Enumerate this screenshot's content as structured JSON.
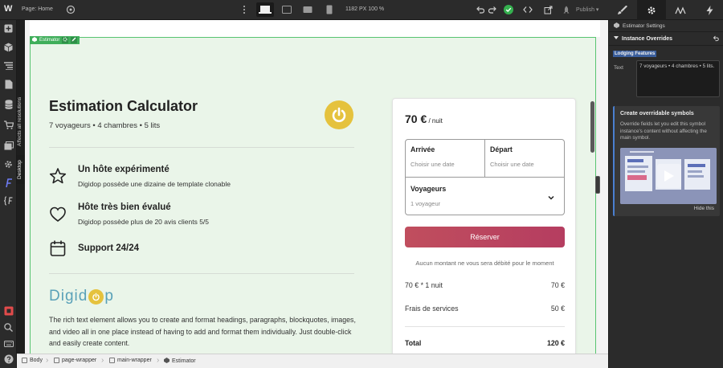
{
  "topbar": {
    "logo": "W",
    "page_label": "Page: Home",
    "dimensions": "1182 PX  100 %",
    "publish_label": "Publish ▾"
  },
  "left_toolbar": {
    "vertical_labels": [
      "Affects all resolutions",
      "Desktop"
    ]
  },
  "canvas": {
    "symbol_tag": "Estimator",
    "calculator": {
      "title": "Estimation Calculator",
      "subtitle": "7 voyageurs • 4 chambres •  5 lits"
    },
    "features": [
      {
        "title": "Un hôte expérimenté",
        "desc": "Digidop possède une dizaine de template clonable",
        "icon": "star-icon"
      },
      {
        "title": "Hôte très bien évalué",
        "desc": "Digidop possède plus de 20 avis clients 5/5",
        "icon": "heart-icon"
      },
      {
        "title": "Support 24/24",
        "desc": "",
        "icon": "calendar-icon"
      }
    ],
    "brand": {
      "left": "Digid",
      "right": "p"
    },
    "rich_text": "The rich text element allows you to create and format headings, paragraphs, blockquotes, images, and video all in one place instead of having to add and format them individually. Just double-click and easily create content."
  },
  "booking": {
    "price": "70 €",
    "per_night": " / nuit",
    "arrival_label": "Arrivée",
    "arrival_placeholder": "Choisir une date",
    "departure_label": "Départ",
    "departure_placeholder": "Choisir une date",
    "travelers_label": "Voyageurs",
    "travelers_value": "1 voyageur",
    "reserve_label": "Réserver",
    "no_charge_note": "Aucun montant ne vous sera débité pour le moment",
    "lines": [
      {
        "label": "70 € * 1 nuit",
        "value": "70 €"
      },
      {
        "label": "Frais de services",
        "value": "50 €"
      }
    ],
    "total_label": "Total",
    "total_value": "120 €",
    "accent_color": "#b9455f"
  },
  "breadcrumbs": [
    "Body",
    "page-wrapper",
    "main-wrapper",
    "Estimator"
  ],
  "right_panel": {
    "header": "Estimator Settings",
    "section": "Instance Overrides",
    "property_label": "Lodging Features",
    "field_label": "Text",
    "field_value": "7 voyageurs • 4 chambres •  5 lits.",
    "tip_title": "Create overridable symbols",
    "tip_text": "Override fields let you edit this symbol instance's content without affecting the main symbol.",
    "hide_label": "Hide this"
  }
}
